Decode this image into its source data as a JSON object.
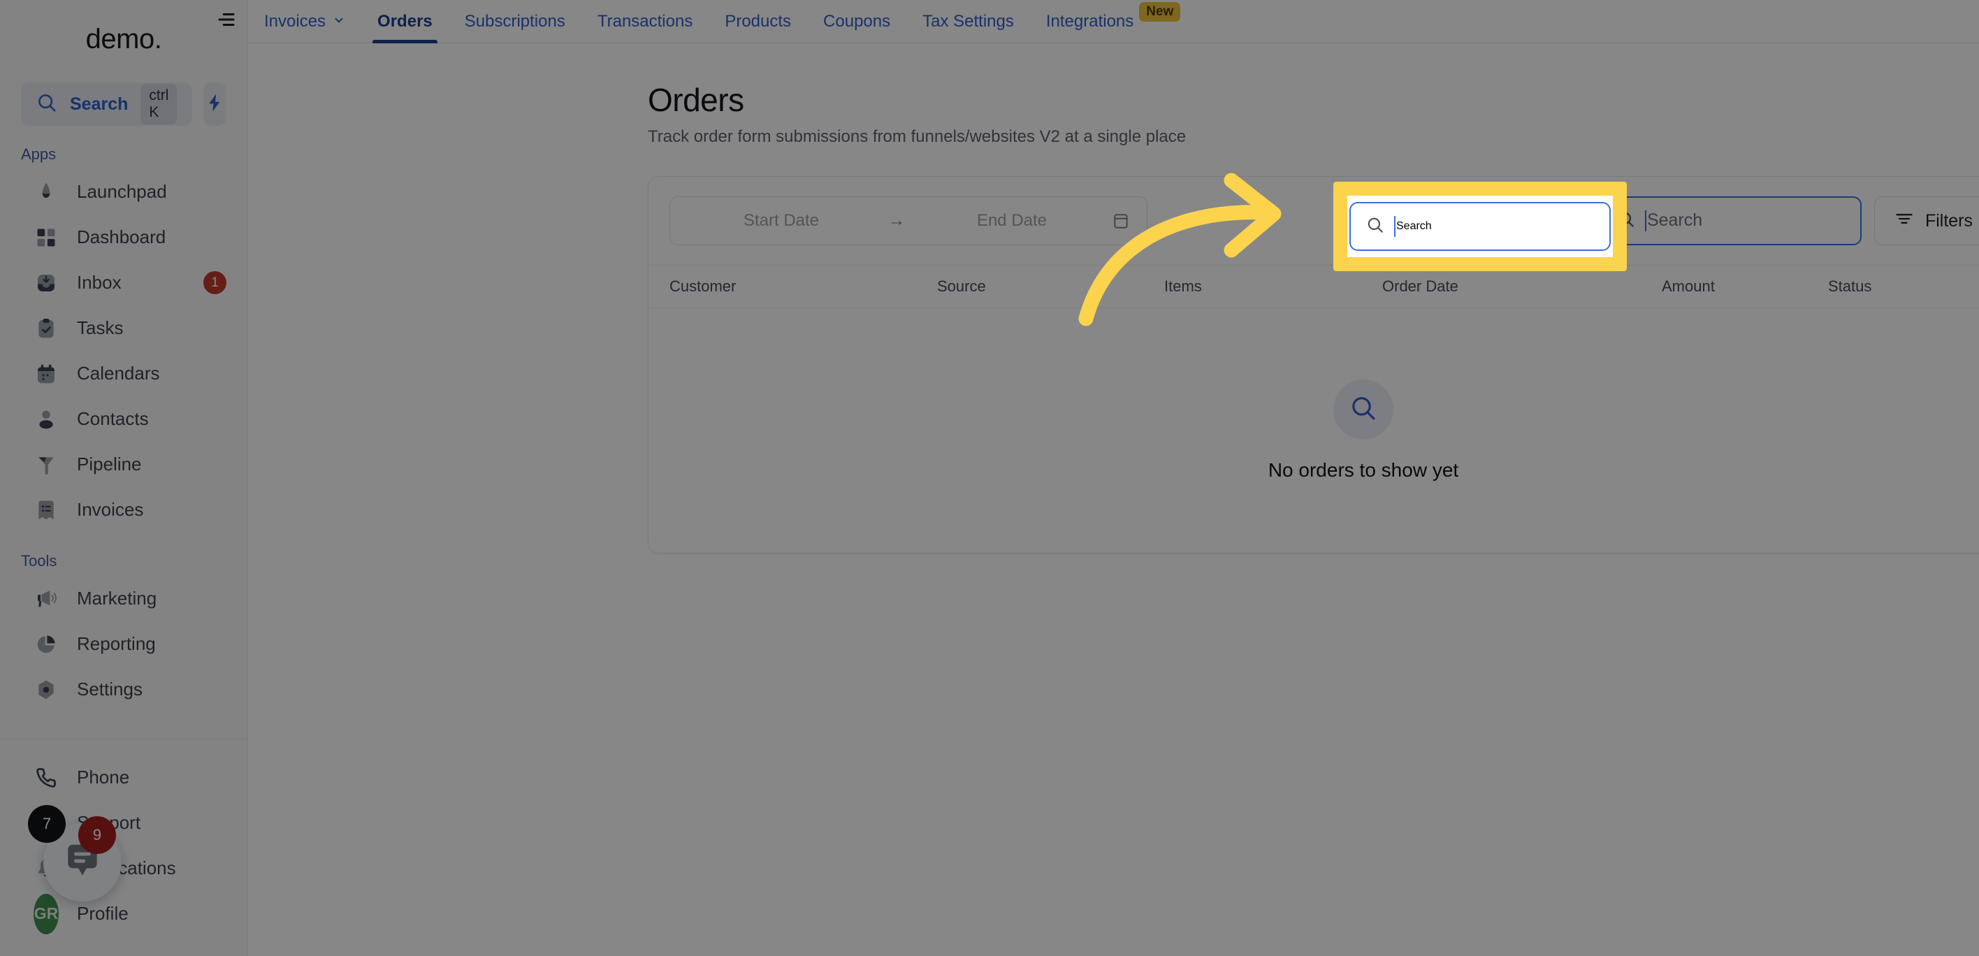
{
  "brand": {
    "name": "demo",
    "dot": "."
  },
  "sidebar": {
    "search": {
      "label": "Search",
      "shortcut": "ctrl K",
      "icon": "search-icon"
    },
    "quick_action": {
      "icon": "bolt-icon"
    },
    "groups": [
      {
        "label": "Apps",
        "items": [
          {
            "label": "Launchpad",
            "icon": "rocket-icon",
            "badge": ""
          },
          {
            "label": "Dashboard",
            "icon": "grid-icon",
            "badge": ""
          },
          {
            "label": "Inbox",
            "icon": "inbox-icon",
            "badge": "1"
          },
          {
            "label": "Tasks",
            "icon": "clipboard-check-icon",
            "badge": ""
          },
          {
            "label": "Calendars",
            "icon": "calendar-icon",
            "badge": ""
          },
          {
            "label": "Contacts",
            "icon": "person-icon",
            "badge": ""
          },
          {
            "label": "Pipeline",
            "icon": "funnel-icon",
            "badge": ""
          },
          {
            "label": "Invoices",
            "icon": "invoice-icon",
            "badge": ""
          }
        ]
      },
      {
        "label": "Tools",
        "items": [
          {
            "label": "Marketing",
            "icon": "megaphone-icon",
            "badge": ""
          },
          {
            "label": "Reporting",
            "icon": "pie-chart-icon",
            "badge": ""
          },
          {
            "label": "Settings",
            "icon": "gear-icon",
            "badge": ""
          }
        ]
      }
    ],
    "bottom_items": [
      {
        "label": "Phone",
        "icon": "phone-icon",
        "badge": ""
      },
      {
        "label": "Support",
        "icon": "chat-dots-icon",
        "badge": ""
      },
      {
        "label": "Notifications",
        "icon": "bell-icon",
        "badge": ""
      },
      {
        "label": "Profile",
        "icon": "avatar-icon",
        "badge": ""
      }
    ],
    "profile_initials": "GR",
    "chat_widget": {
      "icon": "chat-bubble-icon",
      "badge_dark": "7",
      "badge_red": "9"
    }
  },
  "topbar": {
    "menu_icon": "hamburger-icon",
    "tabs": [
      {
        "label": "Invoices",
        "active": false,
        "caret": true,
        "badge": ""
      },
      {
        "label": "Orders",
        "active": true,
        "caret": false,
        "badge": ""
      },
      {
        "label": "Subscriptions",
        "active": false,
        "caret": false,
        "badge": ""
      },
      {
        "label": "Transactions",
        "active": false,
        "caret": false,
        "badge": ""
      },
      {
        "label": "Products",
        "active": false,
        "caret": false,
        "badge": ""
      },
      {
        "label": "Coupons",
        "active": false,
        "caret": false,
        "badge": ""
      },
      {
        "label": "Tax Settings",
        "active": false,
        "caret": false,
        "badge": ""
      },
      {
        "label": "Integrations",
        "active": false,
        "caret": false,
        "badge": "New"
      }
    ]
  },
  "page": {
    "title": "Orders",
    "subtitle": "Track order form submissions from funnels/websites V2 at a single place"
  },
  "toolbar": {
    "start_date_placeholder": "Start Date",
    "end_date_placeholder": "End Date",
    "range_arrow": "→",
    "calendar_icon": "calendar-icon",
    "search_placeholder": "Search",
    "search_value": "",
    "search_icon": "search-icon",
    "filters_label": "Filters",
    "filters_icon": "filter-icon",
    "download_icon": "download-circle-icon"
  },
  "table": {
    "columns": [
      "Customer",
      "Source",
      "Items",
      "Order Date",
      "Amount",
      "Status"
    ],
    "rows": [],
    "empty_message": "No orders to show yet",
    "empty_icon": "search-icon"
  },
  "annotation": {
    "highlight_color": "#fcd34d",
    "arrow_color": "#fcd34d",
    "target": "search-input"
  }
}
